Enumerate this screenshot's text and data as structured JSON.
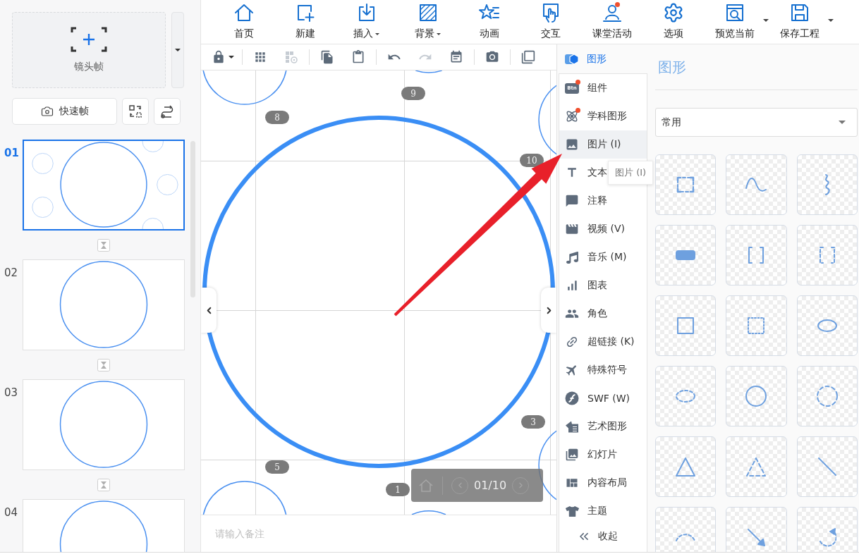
{
  "left_panel": {
    "add_frame": {
      "label": "镜头帧"
    },
    "quick_frame": {
      "label": "快速帧"
    },
    "slides": [
      {
        "number": "01",
        "selected": true,
        "kind": "overview"
      },
      {
        "number": "02",
        "selected": false,
        "kind": "circle"
      },
      {
        "number": "03",
        "selected": false,
        "kind": "circle"
      },
      {
        "number": "04",
        "selected": false,
        "kind": "circle"
      }
    ]
  },
  "toolbar": [
    {
      "label": "首页",
      "kind": "home",
      "dropdown": false,
      "dot": false
    },
    {
      "label": "新建",
      "kind": "new",
      "dropdown": false,
      "dot": false
    },
    {
      "label": "插入",
      "kind": "insert",
      "dropdown": true,
      "split": false,
      "dot": false
    },
    {
      "label": "背景",
      "kind": "background",
      "dropdown": true,
      "split": false,
      "dot": false
    },
    {
      "label": "动画",
      "kind": "animation",
      "dropdown": false,
      "dot": false
    },
    {
      "label": "交互",
      "kind": "interaction",
      "dropdown": false,
      "dot": false
    },
    {
      "label": "课堂活动",
      "kind": "classroom",
      "dropdown": false,
      "dot": true
    },
    {
      "label": "选项",
      "kind": "options",
      "dropdown": false,
      "dot": false
    },
    {
      "label": "预览当前",
      "kind": "preview",
      "dropdown": true,
      "split": true,
      "dot": false
    },
    {
      "label": "保存工程",
      "kind": "save",
      "dropdown": true,
      "split": true,
      "dot": false
    }
  ],
  "edit_toolbar": [
    [
      {
        "kind": "lock",
        "disabled": false,
        "dropdown": true
      }
    ],
    [
      {
        "kind": "grid",
        "disabled": false,
        "dropdown": false
      },
      {
        "kind": "grid-settings",
        "disabled": true,
        "dropdown": false
      }
    ],
    [
      {
        "kind": "copy",
        "disabled": false,
        "dropdown": false
      },
      {
        "kind": "paste",
        "disabled": false,
        "dropdown": false
      }
    ],
    [
      {
        "kind": "undo",
        "disabled": false,
        "dropdown": false
      },
      {
        "kind": "redo",
        "disabled": true,
        "dropdown": false
      },
      {
        "kind": "schedule",
        "disabled": false,
        "dropdown": false
      }
    ],
    [
      {
        "kind": "camera",
        "disabled": false,
        "dropdown": false
      }
    ],
    [
      {
        "kind": "restore",
        "disabled": false,
        "dropdown": false
      }
    ]
  ],
  "canvas": {
    "badges": [
      "8",
      "9",
      "10",
      "3",
      "5",
      "1"
    ],
    "navigator": {
      "page": "01/10"
    },
    "notes": {
      "placeholder": "请输入备注"
    }
  },
  "insert_menu": {
    "header": {
      "label": "图形",
      "selected": true
    },
    "items": [
      {
        "label": "组件",
        "kind": "component",
        "icon_text": "Btn",
        "dot": true,
        "selected": false,
        "hovered": false
      },
      {
        "label": "学科图形",
        "kind": "subject",
        "dot": true,
        "selected": false,
        "hovered": false
      },
      {
        "label": "图片 (I)",
        "kind": "image",
        "dot": false,
        "selected": false,
        "hovered": true
      },
      {
        "label": "文本",
        "kind": "text",
        "dot": false,
        "selected": false,
        "hovered": false
      },
      {
        "label": "注释",
        "kind": "note",
        "dot": false,
        "selected": false,
        "hovered": false
      },
      {
        "label": "视频 (V)",
        "kind": "video",
        "dot": false,
        "selected": false,
        "hovered": false
      },
      {
        "label": "音乐 (M)",
        "kind": "music",
        "dot": false,
        "selected": false,
        "hovered": false
      },
      {
        "label": "图表",
        "kind": "chart",
        "dot": false,
        "selected": false,
        "hovered": false
      },
      {
        "label": "角色",
        "kind": "role",
        "dot": false,
        "selected": false,
        "hovered": false
      },
      {
        "label": "超链接 (K)",
        "kind": "link",
        "dot": false,
        "selected": false,
        "hovered": false
      },
      {
        "label": "特殊符号",
        "kind": "symbol",
        "dot": false,
        "selected": false,
        "hovered": false
      },
      {
        "label": "SWF (W)",
        "kind": "swf",
        "dot": false,
        "selected": false,
        "hovered": false
      },
      {
        "label": "艺术图形",
        "kind": "art",
        "dot": false,
        "selected": false,
        "hovered": false
      },
      {
        "label": "幻灯片",
        "kind": "slides",
        "dot": false,
        "selected": false,
        "hovered": false
      },
      {
        "label": "内容布局",
        "kind": "layout",
        "dot": false,
        "selected": false,
        "hovered": false
      },
      {
        "label": "主题",
        "kind": "theme",
        "dot": false,
        "selected": false,
        "hovered": false
      }
    ],
    "collapse": {
      "label": "收起"
    }
  },
  "tooltip": {
    "text": "图片 (I)"
  },
  "shapes_panel": {
    "title": "图形",
    "category": {
      "value": "常用"
    },
    "tiles": [
      {
        "kind": "corner-rect"
      },
      {
        "kind": "wave"
      },
      {
        "kind": "squiggle"
      },
      {
        "kind": "filled-rect"
      },
      {
        "kind": "brackets"
      },
      {
        "kind": "dashed-brackets"
      },
      {
        "kind": "square"
      },
      {
        "kind": "dotted-square"
      },
      {
        "kind": "ellipse"
      },
      {
        "kind": "dashed-ellipse"
      },
      {
        "kind": "circle"
      },
      {
        "kind": "dashed-circle"
      },
      {
        "kind": "triangle"
      },
      {
        "kind": "dashed-triangle"
      },
      {
        "kind": "line"
      },
      {
        "kind": "dashed-arc"
      },
      {
        "kind": "arrow-line"
      },
      {
        "kind": "circular-arrow"
      }
    ]
  }
}
